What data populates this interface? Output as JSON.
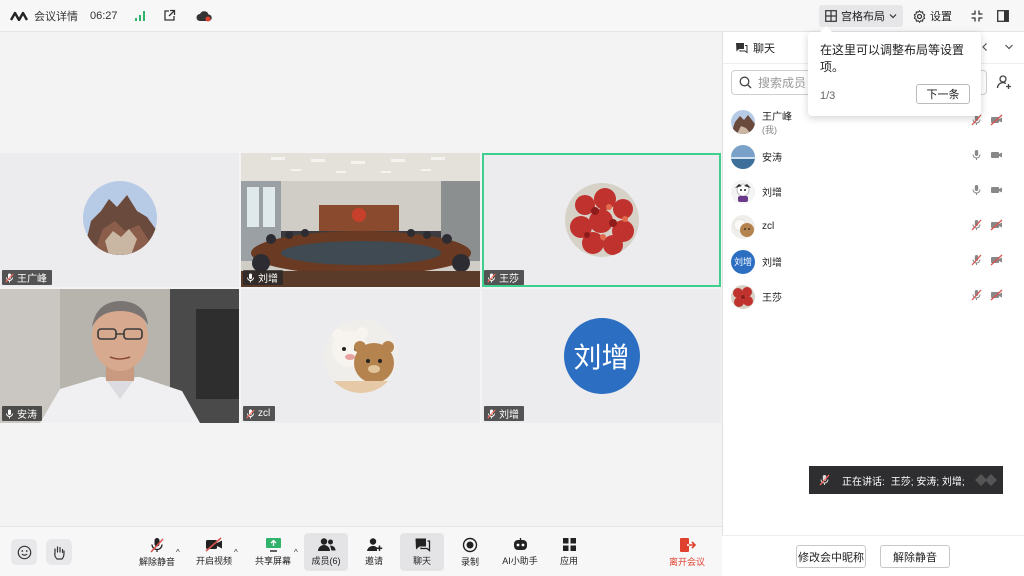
{
  "topbar": {
    "title": "会议详情",
    "time": "06:27",
    "layout_label": "宫格布局",
    "settings_label": "设置"
  },
  "tiles": [
    {
      "name": "王广峰",
      "type": "avatar",
      "mic": "muted"
    },
    {
      "name": "刘增",
      "type": "video",
      "mic": "on"
    },
    {
      "name": "王莎",
      "type": "avatar",
      "mic": "muted"
    },
    {
      "name": "安涛",
      "type": "video",
      "mic": "on"
    },
    {
      "name": "zcl",
      "type": "avatar",
      "mic": "muted"
    },
    {
      "name": "刘增",
      "type": "initials",
      "initials": "刘增",
      "mic": "muted"
    }
  ],
  "panel": {
    "title": "聊天",
    "search_placeholder": "搜索成员",
    "members": [
      {
        "name": "王广峰",
        "sub": "(我)",
        "mic": "muted",
        "cam": "off"
      },
      {
        "name": "安涛",
        "sub": "",
        "mic": "on",
        "cam": "on"
      },
      {
        "name": "刘增",
        "sub": "",
        "mic": "on",
        "cam": "on"
      },
      {
        "name": "zcl",
        "sub": "",
        "mic": "muted",
        "cam": "off"
      },
      {
        "name": "刘增",
        "sub": "",
        "avatar_text": "刘增",
        "mic": "muted",
        "cam": "off"
      },
      {
        "name": "王莎",
        "sub": "",
        "mic": "muted",
        "cam": "off"
      }
    ],
    "rename_button": "修改会中昵称",
    "unmute_all_button": "解除静音"
  },
  "tooltip": {
    "message": "在这里可以调整布局等设置项。",
    "step": "1/3",
    "next_label": "下一条"
  },
  "speaking": {
    "label": "正在讲话:",
    "names": "王莎; 安涛; 刘增;"
  },
  "toolbar": {
    "unmute": "解除静音",
    "video": "开启视频",
    "share": "共享屏幕",
    "members": "成员(6)",
    "invite": "邀请",
    "chat": "聊天",
    "record": "录制",
    "assistant": "AI小助手",
    "apps": "应用",
    "leave": "离开会议"
  },
  "colors": {
    "accent": "#2b6ec2",
    "speaking_border": "#3ecf8e",
    "leave": "#e0412e",
    "muted_icon": "#d9534f"
  }
}
